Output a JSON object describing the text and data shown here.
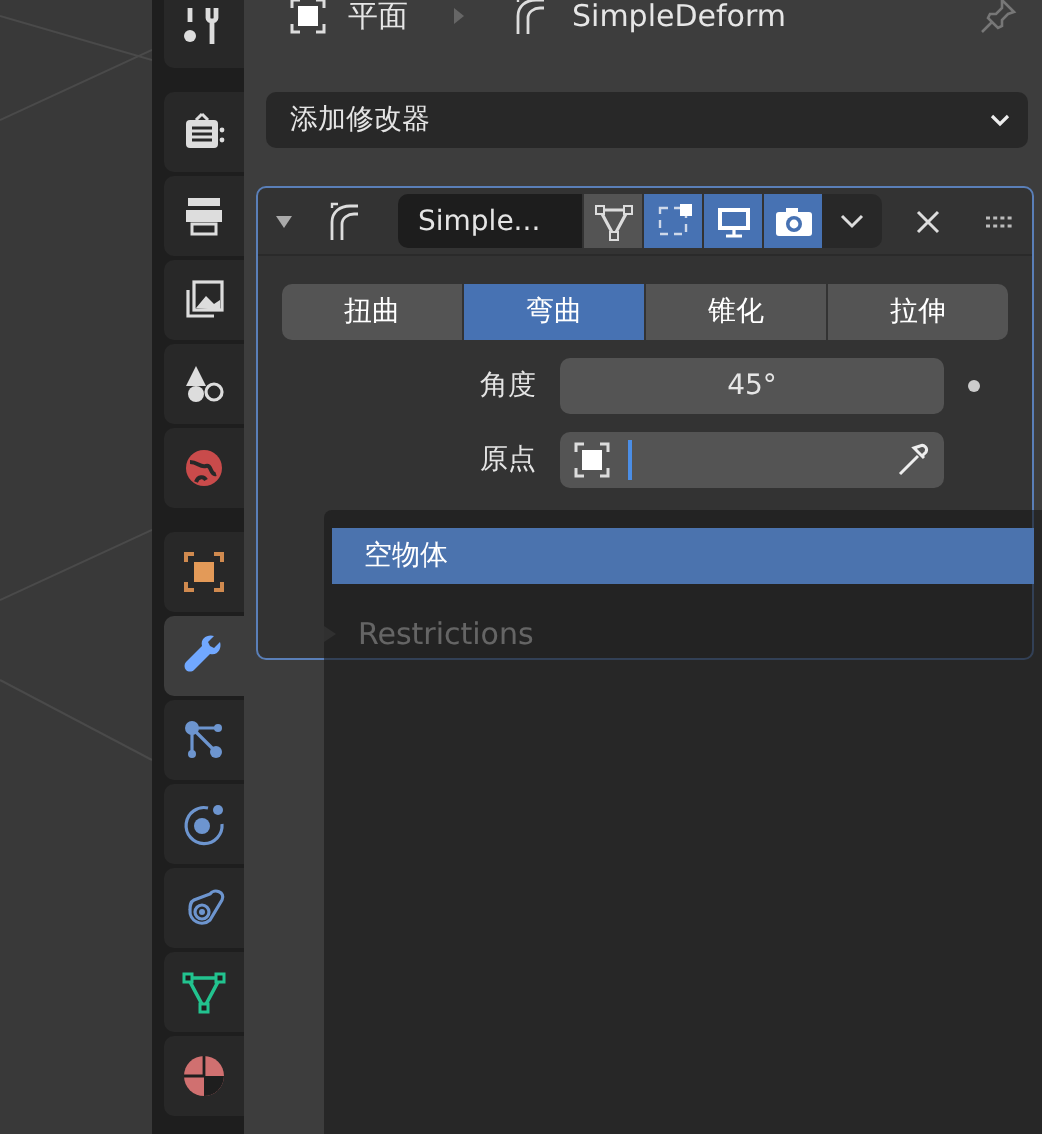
{
  "header": {
    "object_name": "平面",
    "modifier_name": "SimpleDeform"
  },
  "add_modifier": {
    "label": "添加修改器"
  },
  "sidebar": {
    "tabs": [
      {
        "kind": "tool",
        "selected": false
      },
      {
        "kind": "render",
        "selected": false
      },
      {
        "kind": "output",
        "selected": false
      },
      {
        "kind": "view_layer",
        "selected": false
      },
      {
        "kind": "scene",
        "selected": false
      },
      {
        "kind": "world",
        "selected": false
      },
      {
        "kind": "object",
        "selected": false
      },
      {
        "kind": "modifiers",
        "selected": true
      },
      {
        "kind": "particles",
        "selected": false
      },
      {
        "kind": "physics",
        "selected": false
      },
      {
        "kind": "constraints",
        "selected": false
      },
      {
        "kind": "data",
        "selected": false
      },
      {
        "kind": "material",
        "selected": false
      }
    ]
  },
  "modifier": {
    "expanded": true,
    "name": "Simple...",
    "toggles": [
      {
        "kind": "edit_mode",
        "on": false
      },
      {
        "kind": "cage",
        "on": true
      },
      {
        "kind": "viewport",
        "on": true
      },
      {
        "kind": "render",
        "on": true
      }
    ],
    "modes": [
      {
        "label": "扭曲",
        "selected": false
      },
      {
        "label": "弯曲",
        "selected": true
      },
      {
        "label": "锥化",
        "selected": false
      },
      {
        "label": "拉伸",
        "selected": false
      }
    ],
    "angle": {
      "label": "角度",
      "value": "45°"
    },
    "origin": {
      "label": "原点"
    },
    "restrictions": {
      "label": "Restrictions",
      "expanded": false
    }
  },
  "popup": {
    "items": [
      {
        "label": "空物体",
        "selected": true
      }
    ]
  }
}
